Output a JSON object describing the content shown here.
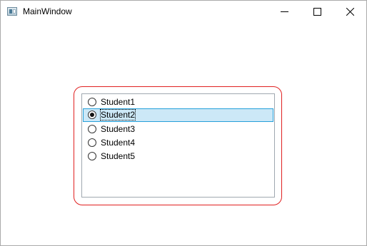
{
  "window": {
    "title": "MainWindow",
    "controls": {
      "minimize_icon": "minimize-icon",
      "maximize_icon": "maximize-icon",
      "close_icon": "close-icon"
    }
  },
  "group": {
    "border_color": "#e02020"
  },
  "listbox": {
    "items": [
      {
        "label": "Student1",
        "checked": false,
        "selected": false
      },
      {
        "label": "Student2",
        "checked": true,
        "selected": true
      },
      {
        "label": "Student3",
        "checked": false,
        "selected": false
      },
      {
        "label": "Student4",
        "checked": false,
        "selected": false
      },
      {
        "label": "Student5",
        "checked": false,
        "selected": false
      }
    ],
    "selection_color": "#cce8f7",
    "selection_border_color": "#26a0da"
  }
}
